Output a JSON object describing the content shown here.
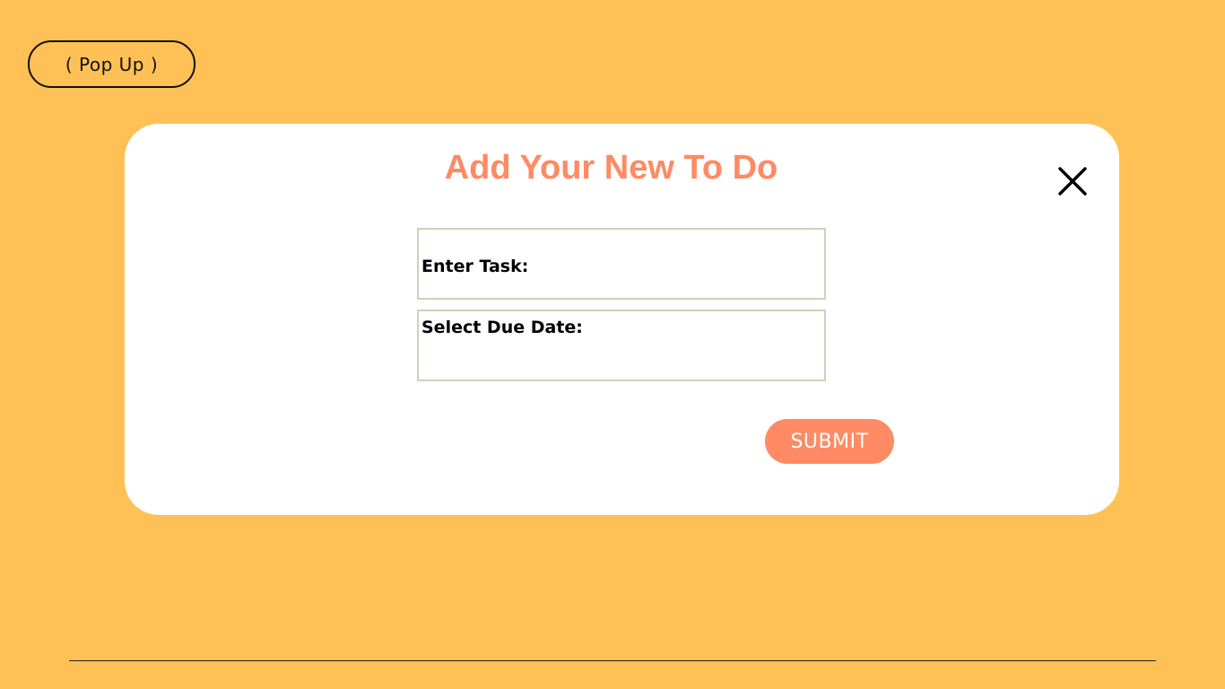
{
  "tag": {
    "label": "( Pop Up )"
  },
  "modal": {
    "title": "Add Your New To Do",
    "close_icon": "close-icon",
    "fields": {
      "task_label": "Enter Task:",
      "task_value": "",
      "date_label": "Select Due Date:",
      "date_value": ""
    },
    "submit_label": "SUBMIT"
  },
  "colors": {
    "background": "#FFC155",
    "accent": "#FF8A63",
    "modal_bg": "#FFFFFF",
    "field_border": "#D6CCB8"
  }
}
